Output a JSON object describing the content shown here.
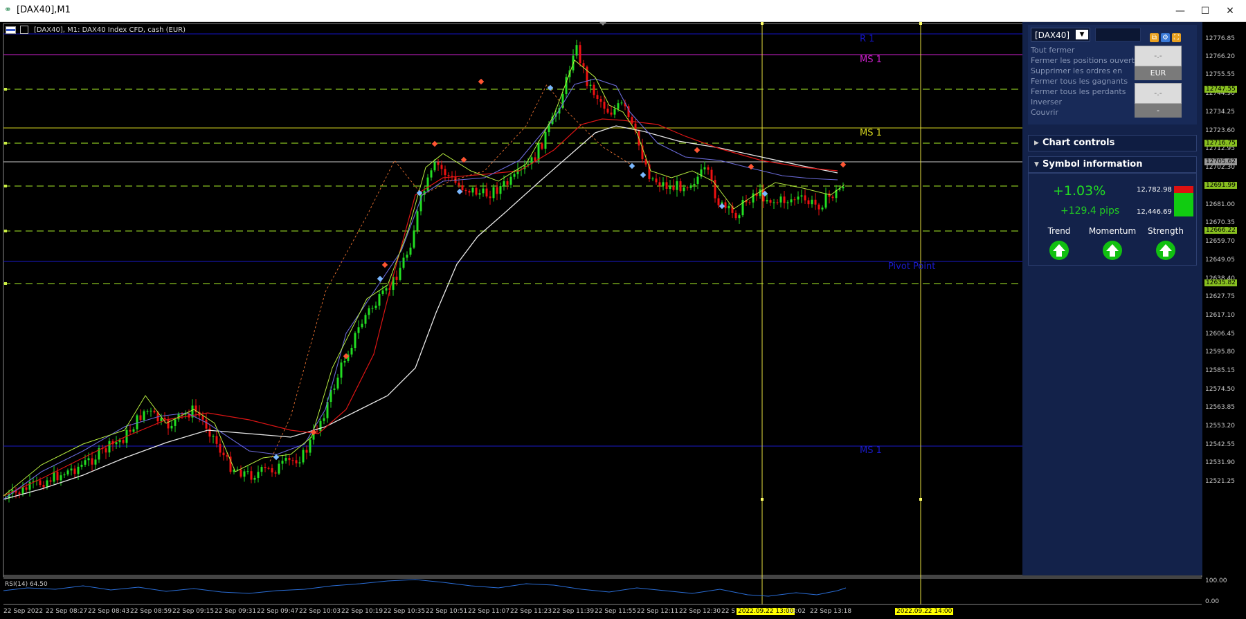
{
  "window": {
    "title": "[DAX40],M1",
    "buttons": {
      "minimize": "—",
      "maximize": "☐",
      "close": "✕"
    }
  },
  "chart": {
    "header": "[DAX40], M1:  DAX40 Index CFD, cash (EUR)",
    "level_labels": {
      "r1": "R 1",
      "ms1_top": "MS 1",
      "ms1_mid": "MS 1",
      "pivot": "Pivot Point",
      "ms1_bottom": "MS 1"
    },
    "price_axis": [
      "12776.85",
      "12766.20",
      "12755.55",
      "12744.90",
      "12734.25",
      "12723.60",
      "12712.95",
      "12702.30",
      "12681.00",
      "12670.35",
      "12659.70",
      "12649.05",
      "12638.40",
      "12627.75",
      "12617.10",
      "12606.45",
      "12595.80",
      "12585.15",
      "12574.50",
      "12563.85",
      "12553.20",
      "12542.55",
      "12531.90",
      "12521.25"
    ],
    "price_tags": {
      "t1": "12747.55",
      "t2": "12716.75",
      "t3": "12705.62",
      "t4": "12691.99",
      "t5": "12666.22",
      "t6": "12635.82"
    },
    "time_axis": [
      "22 Sep 2022",
      "22 Sep 08:27",
      "22 Sep 08:43",
      "22 Sep 08:59",
      "22 Sep 09:15",
      "22 Sep 09:31",
      "22 Sep 09:47",
      "22 Sep 10:03",
      "22 Sep 10:19",
      "22 Sep 10:35",
      "22 Sep 10:51",
      "22 Sep 11:07",
      "22 Sep 11:23",
      "22 Sep 11:39",
      "22 Sep 11:55",
      "22 Sep 12:11",
      "22 Sep 12:30",
      "22 S"
    ],
    "time_tags": {
      "vline1": "2022.09.22 13:00",
      "after1": "13:02",
      "after2": "22 Sep 13:18",
      "vline2": "2022.09.22 14:00"
    },
    "rsi": {
      "label": "RSI(14) 64.50",
      "scale_top": "100.00",
      "scale_bottom": "0.00"
    },
    "colors": {
      "r1": "#1515c8",
      "ms_magenta": "#d020d0",
      "ms_yellow": "#d8d820",
      "pivot": "#1a1acc",
      "dashed": "#88c020",
      "vline": "#e8e040",
      "white_level": "#c8c8c8"
    }
  },
  "panel": {
    "symbol": "[DAX40]",
    "icons": [
      "copy-icon",
      "gear-icon",
      "expand-icon"
    ],
    "actions": [
      "Tout fermer",
      "Fermer les positions ouvertes",
      "Supprimer les ordres en",
      "Fermer tous les gagnants",
      "Fermer tous les perdants",
      "Inverser",
      "Couvrir"
    ],
    "buy_price": "-.-",
    "currency": "EUR",
    "sell_price": "-.-",
    "sell_sub": "-",
    "chart_controls": "Chart controls",
    "symbol_information": "Symbol information",
    "change_pct": "+1.03%",
    "change_pips": "+129.4 pips",
    "day_high": "12,782.98",
    "day_low": "12,446.69",
    "indicators": [
      {
        "label": "Trend",
        "state": "up"
      },
      {
        "label": "Momentum",
        "state": "up"
      },
      {
        "label": "Strength",
        "state": "up"
      }
    ]
  }
}
